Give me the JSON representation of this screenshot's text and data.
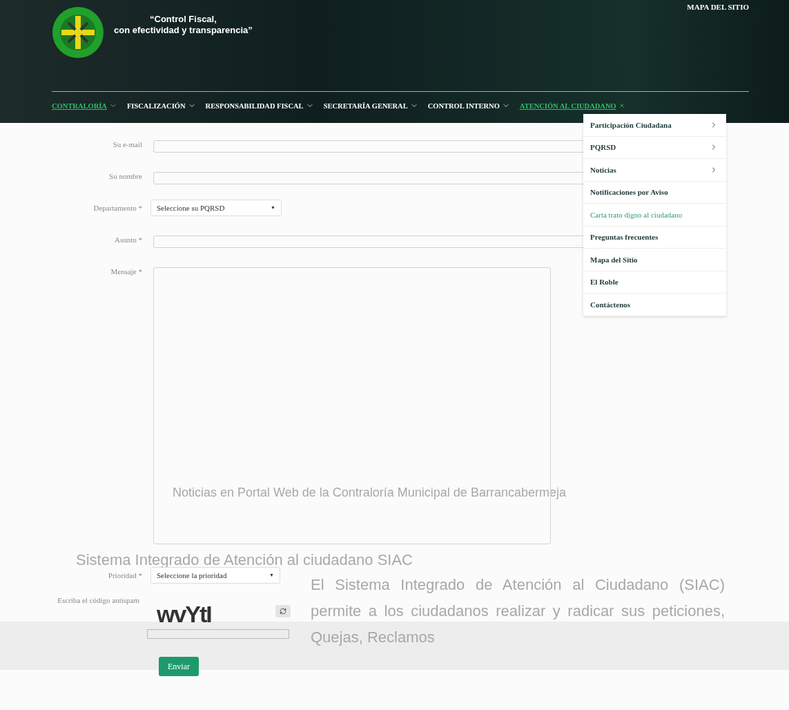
{
  "header": {
    "tagline_line_1": "“Control Fiscal,",
    "tagline_line_2": "con efectividad y transparencia”",
    "top_link": "MAPA DEL SITIO"
  },
  "nav": [
    {
      "label": "CONTRALORÍA",
      "selected": true,
      "expanded": false
    },
    {
      "label": "FISCALIZACIÓN",
      "selected": false,
      "expanded": false
    },
    {
      "label": "RESPONSABILIDAD FISCAL",
      "selected": false,
      "expanded": false
    },
    {
      "label": "SECRETARÍA GENERAL",
      "selected": false,
      "expanded": false
    },
    {
      "label": "CONTROL INTERNO",
      "selected": false,
      "expanded": false
    },
    {
      "label": "ATENCIÓN AL CIUDADANO",
      "selected": true,
      "expanded": true
    }
  ],
  "dropdown": [
    {
      "label": "Participación Ciudadana",
      "submenu": true,
      "selected": false
    },
    {
      "label": "PQRSD",
      "submenu": true,
      "selected": false
    },
    {
      "label": "Noticias",
      "submenu": true,
      "selected": false
    },
    {
      "label": "Notificaciones por Aviso",
      "submenu": false,
      "selected": false
    },
    {
      "label": "Carta trato digno al ciudadano",
      "submenu": false,
      "selected": true
    },
    {
      "label": "Preguntas frecuentes",
      "submenu": false,
      "selected": false
    },
    {
      "label": "Mapa del Sitio",
      "submenu": false,
      "selected": false
    },
    {
      "label": "El Roble",
      "submenu": false,
      "selected": false
    },
    {
      "label": "Contáctenos",
      "submenu": false,
      "selected": false
    }
  ],
  "form": {
    "fields": [
      {
        "kind": "text",
        "label": "Su e-mail"
      },
      {
        "kind": "text",
        "label": "Su nombre"
      },
      {
        "kind": "select",
        "label": "Departamento *",
        "value": "Seleccione su PQRSD",
        "caret": "▼"
      },
      {
        "kind": "text",
        "label": "Asunto *"
      },
      {
        "kind": "textarea",
        "label": "Mensaje *"
      },
      {
        "kind": "select",
        "label": "Prioridad *",
        "value": "Seleccione la prioridad",
        "caret": "▼"
      },
      {
        "kind": "captcha",
        "label": "Escriba el código antispam",
        "code": "wvYtI"
      }
    ],
    "submit": "Enviar"
  },
  "background": {
    "news_line": "Noticias en Portal Web de la Contraloría Municipal de Barrancabermeja",
    "heading": "Sistema Integrado de Atención al ciudadano SIAC",
    "paragraph": "El Sistema Integrado de Atención al Ciudadano (SIAC) permite a los ciudadanos realizar y radicar sus peticiones, Quejas, Reclamos"
  }
}
